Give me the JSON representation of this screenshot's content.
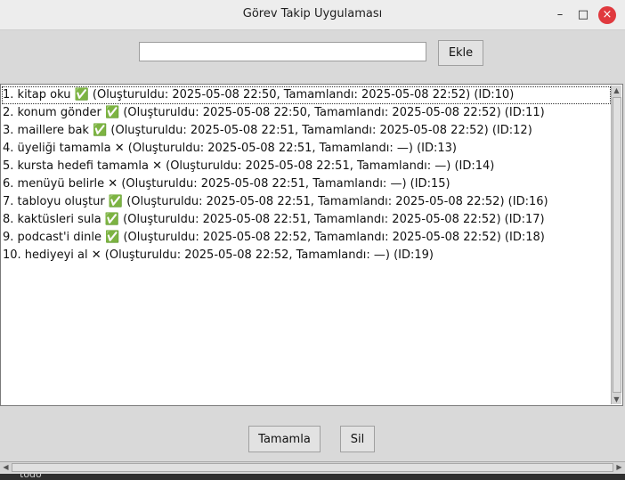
{
  "window": {
    "title": "Görev Takip Uygulaması",
    "controls": {
      "minimize": "–",
      "maximize": "□",
      "close": "×"
    }
  },
  "input": {
    "value": "",
    "placeholder": ""
  },
  "buttons": {
    "add": "Ekle",
    "complete": "Tamamla",
    "delete": "Sil"
  },
  "tasks": [
    "1. kitap oku ✅ (Oluşturuldu: 2025-05-08 22:50, Tamamlandı: 2025-05-08 22:52) (ID:10)",
    "2. konum gönder ✅ (Oluşturuldu: 2025-05-08 22:50, Tamamlandı: 2025-05-08 22:52) (ID:11)",
    "3. maillere bak ✅ (Oluşturuldu: 2025-05-08 22:51, Tamamlandı: 2025-05-08 22:52) (ID:12)",
    "4. üyeliği tamamla ✕ (Oluşturuldu: 2025-05-08 22:51, Tamamlandı: —) (ID:13)",
    "5. kursta hedefi tamamla ✕ (Oluşturuldu: 2025-05-08 22:51, Tamamlandı: —) (ID:14)",
    "6. menüyü belirle ✕ (Oluşturuldu: 2025-05-08 22:51, Tamamlandı: —) (ID:15)",
    "7. tabloyu oluştur ✅ (Oluşturuldu: 2025-05-08 22:51, Tamamlandı: 2025-05-08 22:52) (ID:16)",
    "8. kaktüsleri sula ✅ (Oluşturuldu: 2025-05-08 22:51, Tamamlandı: 2025-05-08 22:52) (ID:17)",
    "9. podcast'i dinle ✅ (Oluşturuldu: 2025-05-08 22:52, Tamamlandı: 2025-05-08 22:52) (ID:18)",
    "10. hediyeyi al ✕ (Oluşturuldu: 2025-05-08 22:52, Tamamlandı: —) (ID:19)"
  ],
  "taskbar": {
    "label": "todo"
  },
  "colors": {
    "close_button": "#e0393e",
    "window_bg": "#d9d9d9",
    "list_bg": "#ffffff"
  }
}
